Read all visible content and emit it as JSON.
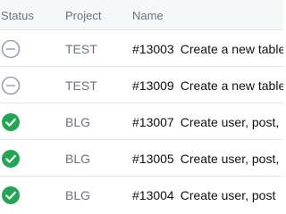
{
  "table": {
    "columns": {
      "status": "Status",
      "project": "Project",
      "name": "Name"
    },
    "rows": [
      {
        "status": "pending",
        "status_icon": "circle-minus-icon",
        "project": "TEST",
        "ticket": "#13003",
        "title": "Create a new table"
      },
      {
        "status": "pending",
        "status_icon": "circle-minus-icon",
        "project": "TEST",
        "ticket": "#13009",
        "title": "Create a new table"
      },
      {
        "status": "success",
        "status_icon": "check-circle-icon",
        "project": "BLG",
        "ticket": "#13007",
        "title": "Create user, post,"
      },
      {
        "status": "success",
        "status_icon": "check-circle-icon",
        "project": "BLG",
        "ticket": "#13005",
        "title": "Create user, post,"
      },
      {
        "status": "success",
        "status_icon": "check-circle-icon",
        "project": "BLG",
        "ticket": "#13004",
        "title": "Create user, post"
      }
    ]
  },
  "colors": {
    "success": "#22a653",
    "pending": "#9ca3af",
    "header_bg": "#f6f7f8",
    "muted_text": "#6b7280"
  }
}
